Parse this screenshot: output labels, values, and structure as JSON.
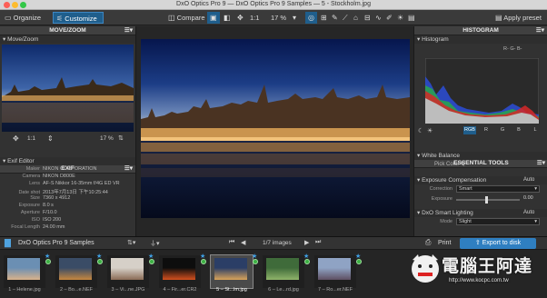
{
  "window": {
    "title": "DxO Optics Pro 9 — DxO Optics Pro 9 Samples — 5 - Stockholm.jpg"
  },
  "toolbar": {
    "organize_label": "Organize",
    "customize_label": "Customize",
    "compare_label": "Compare",
    "zoom_ratio": "1:1",
    "zoom_percent": "17 %",
    "apply_preset_label": "Apply preset"
  },
  "left": {
    "move_zoom_header": "MOVE/ZOOM",
    "move_zoom_sub": "Move/Zoom",
    "nav_ratio": "1:1",
    "nav_percent": "17 %",
    "exif_header": "EXIF",
    "exif_sub": "Exif Editor",
    "exif": [
      {
        "label": "Maker",
        "value": "NIKON CORPORATION"
      },
      {
        "label": "Camera",
        "value": "NIKON D800E"
      },
      {
        "label": "Lens",
        "value": "AF-S Nikkor 16-35mm f/4G ED VR"
      },
      {
        "label": "Date shot",
        "value": "2013年7月13日 下午10:25:44"
      },
      {
        "label": "Size",
        "value": "7360 x 4912"
      },
      {
        "label": "Exposure",
        "value": "8.0 s"
      },
      {
        "label": "Aperture",
        "value": "F/10.0"
      },
      {
        "label": "ISO",
        "value": "ISO 200"
      },
      {
        "label": "Focal Length",
        "value": "24.00 mm"
      }
    ]
  },
  "right": {
    "histogram_header": "HISTOGRAM",
    "histogram_sub": "Histogram",
    "rgb_readout": "R- G- B-",
    "channels": [
      "RGB",
      "R",
      "G",
      "B",
      "L"
    ],
    "essential_header": "ESSENTIAL TOOLS",
    "white_balance": "White Balance",
    "pick_color": "Pick Color",
    "exposure_comp": "Exposure Compensation",
    "exposure_auto": "Auto",
    "correction_label": "Correction",
    "correction_value": "Smart",
    "exposure_label": "Exposure",
    "exposure_value": "0.00",
    "smart_lighting": "DxO Smart Lighting",
    "smart_auto": "Auto",
    "mode_label": "Mode",
    "mode_value": "Slight"
  },
  "filmstrip": {
    "folder": "DxO Optics Pro 9 Samples",
    "counter": "1/7 images",
    "print_label": "Print",
    "export_label": "Export to disk",
    "items": [
      {
        "caption": "1 – Helene.jpg",
        "colors": [
          "#6b8fb3",
          "#d9b28a"
        ]
      },
      {
        "caption": "2 – Bo...e.NEF",
        "colors": [
          "#3a4c66",
          "#c7873f"
        ]
      },
      {
        "caption": "3 – Vi...ne.JPG",
        "colors": [
          "#d6d0c8",
          "#8a6b55"
        ]
      },
      {
        "caption": "4 – Fir...er.CR2",
        "colors": [
          "#0d0d0d",
          "#d4501e"
        ]
      },
      {
        "caption": "5 – St...lm.jpg",
        "colors": [
          "#2b3e66",
          "#d9a35a"
        ]
      },
      {
        "caption": "6 – Le...rd.jpg",
        "colors": [
          "#3f6b3a",
          "#8fb36a"
        ]
      },
      {
        "caption": "7 – Ro...er.NEF",
        "colors": [
          "#8fa3c4",
          "#5e4f62"
        ]
      }
    ]
  },
  "watermark": {
    "brand": "電腦王阿達",
    "url": "http://www.kocpc.com.tw"
  },
  "colors": {
    "accent": "#1f5e8c",
    "export": "#2f7fc1",
    "check": "#3cb043"
  }
}
